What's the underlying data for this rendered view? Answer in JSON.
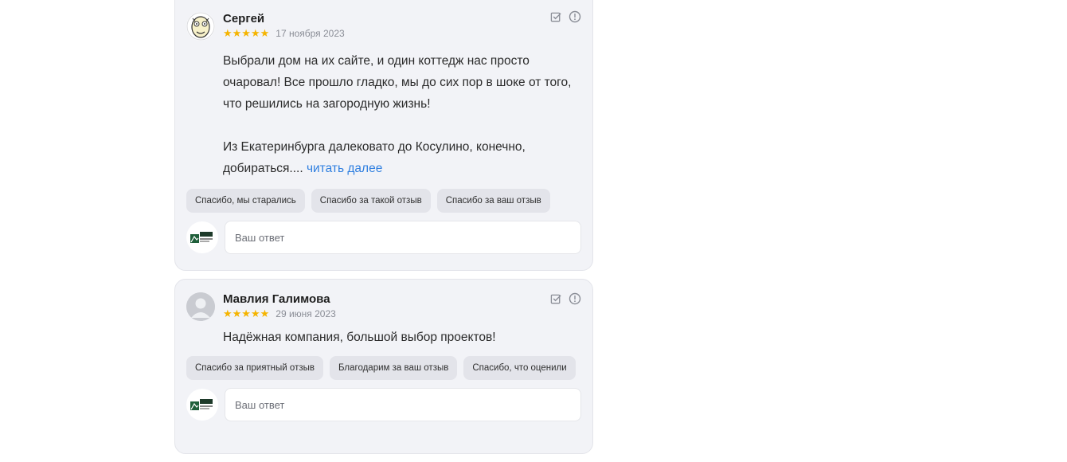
{
  "reviews": [
    {
      "author": "Сергей",
      "rating": 5,
      "stars": "★★★★★",
      "date": "17 ноября 2023",
      "text_para1": "Выбрали дом на их сайте, и один коттедж нас просто\nочаровал! Все прошло гладко, мы до сих пор в шоке от того,\nчто решились на загородную жизнь!",
      "text_para2": "Из Екатеринбурга далековато до Косулино, конечно,\nдобираться.... ",
      "read_more": "читать далее",
      "quick_replies": [
        "Спасибо, мы старались",
        "Спасибо за такой отзыв",
        "Спасибо за ваш отзыв"
      ],
      "reply_placeholder": "Ваш ответ"
    },
    {
      "author": "Мавлия Галимова",
      "rating": 5,
      "stars": "★★★★★",
      "date": "29 июня 2023",
      "text": "Надёжная компания, большой выбор проектов!",
      "quick_replies": [
        "Спасибо за приятный отзыв",
        "Благодарим за ваш отзыв",
        "Спасибо, что оценили"
      ],
      "reply_placeholder": "Ваш ответ"
    }
  ],
  "colors": {
    "card_bg": "#f2f3f7",
    "chip_bg": "#e3e4ea",
    "star": "#f5b400",
    "link": "#2f7fe0"
  },
  "icons": [
    "checkbox-edit-icon",
    "info-icon",
    "company-logo-icon",
    "avatar-placeholder-icon"
  ]
}
